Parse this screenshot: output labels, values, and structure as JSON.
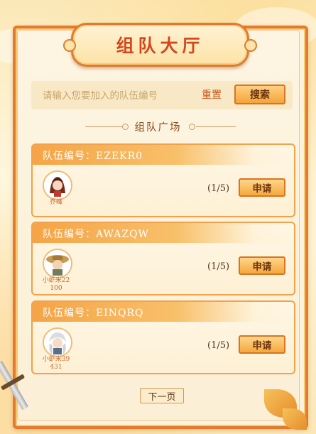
{
  "title": "组队大厅",
  "search": {
    "placeholder": "请输入您要加入的队伍编号",
    "reset_label": "重置",
    "search_label": "搜索"
  },
  "plaza_title": "组队广场",
  "teams": [
    {
      "id_text": "队伍编号：EZEKR0",
      "member_name": "乔峰",
      "count": "(1/5)",
      "apply_label": "申请"
    },
    {
      "id_text": "队伍编号：AWAZQW",
      "member_name": "小虾米22\n100",
      "count": "(1/5)",
      "apply_label": "申请"
    },
    {
      "id_text": "队伍编号：EINQRQ",
      "member_name": "小虾米39\n431",
      "count": "(1/5)",
      "apply_label": "申请"
    }
  ],
  "next_page_label": "下一页",
  "colors": {
    "accent": "#e57b2a",
    "button": "#f5a83d",
    "title": "#d2481a"
  }
}
